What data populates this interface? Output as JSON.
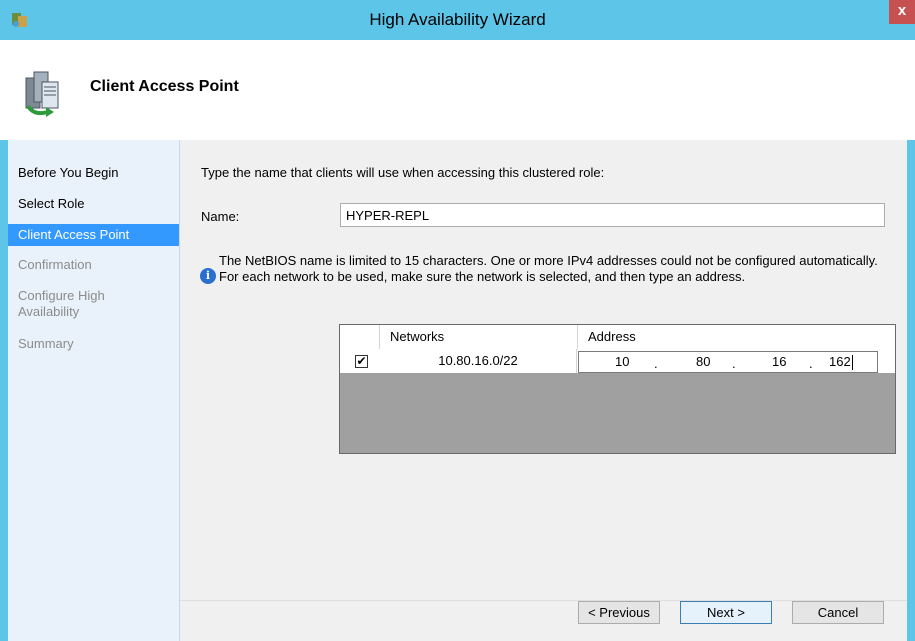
{
  "window": {
    "title": "High Availability Wizard",
    "close_glyph": "x"
  },
  "banner": {
    "title": "Client Access Point",
    "icon": "cluster-wizard-icon"
  },
  "nav": {
    "items": [
      {
        "label": "Before You Begin",
        "state": "done"
      },
      {
        "label": "Select Role",
        "state": "done"
      },
      {
        "label": "Client Access Point",
        "state": "selected"
      },
      {
        "label": "Confirmation",
        "state": "disabled"
      },
      {
        "label": "Configure High Availability",
        "state": "disabled"
      },
      {
        "label": "Summary",
        "state": "disabled"
      }
    ]
  },
  "content": {
    "prompt": "Type the name that clients will use when accessing this clustered role:",
    "name_label": "Name:",
    "name_value": "HYPER-REPL",
    "info_icon": "i",
    "info_text": "The NetBIOS name is limited to 15 characters.  One or more IPv4 addresses could not be configured automatically.  For each network to be used, make sure the network is selected, and then type an address."
  },
  "grid": {
    "headers": {
      "networks": "Networks",
      "address": "Address"
    },
    "rows": [
      {
        "checked": true,
        "check_glyph": "✔",
        "network": "10.80.16.0/22",
        "octets": [
          "10",
          "80",
          "16",
          "162"
        ]
      }
    ]
  },
  "buttons": {
    "previous": "< Previous",
    "next": "Next >",
    "cancel": "Cancel"
  },
  "colors": {
    "title_bar": "#5cc5e8",
    "nav_selected": "#3399ff",
    "close": "#c75050"
  }
}
